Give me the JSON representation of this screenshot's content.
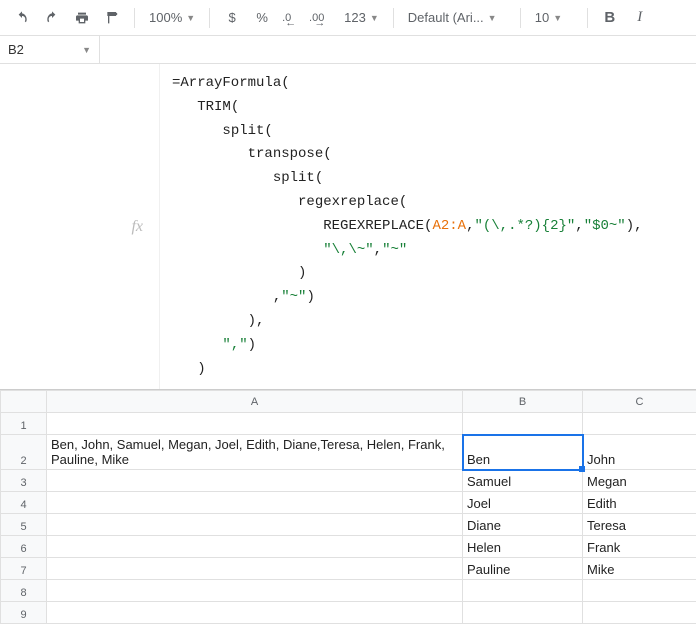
{
  "toolbar": {
    "zoom": "100%",
    "dollar": "$",
    "percent": "%",
    "dec_remove": ".0",
    "dec_add": ".00",
    "numfmt": "123",
    "font": "Default (Ari...",
    "fontsize": "10",
    "bold": "B",
    "italic": "I"
  },
  "namebox": "B2",
  "fx_label": "fx",
  "formula": {
    "l1a": "=ArrayFormula(",
    "l2a": "TRIM(",
    "l3a": "split(",
    "l4a": "transpose(",
    "l5a": "split(",
    "l6a": "regexreplace(",
    "l7a": "REGEXREPLACE(",
    "l7ref": "A2:A",
    "l7s1": "\"(\\,.*?){2}\"",
    "l7s2": "\"$0~\"",
    "l7c": "),",
    "l8s1": "\"\\,\\~\"",
    "l8s2": "\"~\"",
    "l9": ")",
    "l10a": ",",
    "l10s": "\"~\"",
    "l10b": ")",
    "l11": "),",
    "l12s": "\",\"",
    "l12b": ")",
    "l13": ")"
  },
  "headers": {
    "a": "A",
    "b": "B",
    "c": "C"
  },
  "rows": [
    "1",
    "2",
    "3",
    "4",
    "5",
    "6",
    "7",
    "8",
    "9"
  ],
  "cells": {
    "a2": "Ben, John, Samuel, Megan, Joel, Edith, Diane,Teresa, Helen, Frank, Pauline, Mike",
    "b2": "Ben",
    "c2": "John",
    "b3": "Samuel",
    "c3": "Megan",
    "b4": "Joel",
    "c4": "Edith",
    "b5": "Diane",
    "c5": "Teresa",
    "b6": "Helen",
    "c6": "Frank",
    "b7": "Pauline",
    "c7": "Mike"
  }
}
